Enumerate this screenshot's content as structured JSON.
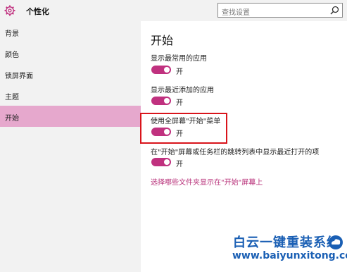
{
  "header": {
    "title": "个性化",
    "icon": "gear-icon",
    "search_placeholder": "查找设置",
    "search_icon": "search-icon"
  },
  "sidebar": {
    "items": [
      {
        "label": "背景",
        "active": false
      },
      {
        "label": "颜色",
        "active": false
      },
      {
        "label": "锁屏界面",
        "active": false
      },
      {
        "label": "主题",
        "active": false
      },
      {
        "label": "开始",
        "active": true
      }
    ],
    "active_color": "#e6a8cd"
  },
  "main": {
    "title": "开始",
    "settings": [
      {
        "label": "显示最常用的应用",
        "state": "开",
        "on": true
      },
      {
        "label": "显示最近添加的应用",
        "state": "开",
        "on": true
      },
      {
        "label": "使用全屏幕\"开始\"菜单",
        "state": "开",
        "on": true
      },
      {
        "label": "在\"开始\"屏幕或任务栏的跳转列表中显示最近打开的项",
        "state": "开",
        "on": true
      }
    ],
    "link": "选择哪些文件夹显示在\"开始\"屏幕上",
    "toggle_color": "#c0317f",
    "highlight_color": "#d9141b"
  },
  "watermark": {
    "title": "白云一键重装系统",
    "url": "www.baiyunxitong.com",
    "color": "#1a5fb4"
  }
}
